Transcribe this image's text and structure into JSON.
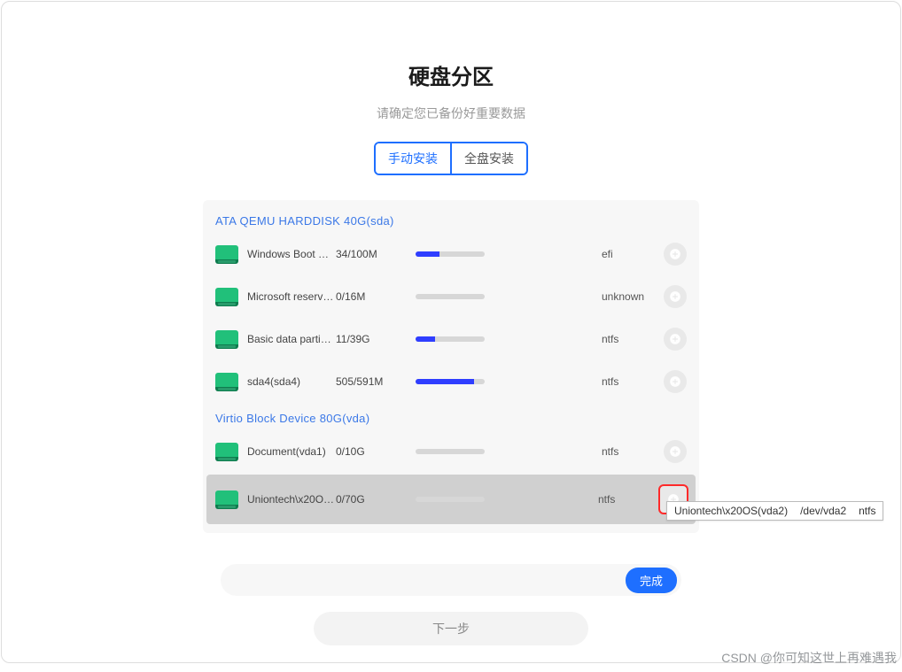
{
  "header": {
    "title": "硬盘分区",
    "subtitle": "请确定您已备份好重要数据",
    "tab_manual": "手动安装",
    "tab_full": "全盘安装"
  },
  "disks": [
    {
      "header": "ATA  QEMU  HARDDISK  40G(sda)",
      "parts": [
        {
          "name": "Windows Boot …",
          "size": "34/100M",
          "fill_pct": 34,
          "fs": "efi",
          "selected": false
        },
        {
          "name": "Microsoft reserv…",
          "size": "0/16M",
          "fill_pct": 0,
          "fs": "unknown",
          "selected": false
        },
        {
          "name": "Basic data parti…",
          "size": "11/39G",
          "fill_pct": 28,
          "fs": "ntfs",
          "selected": false
        },
        {
          "name": "sda4(sda4)",
          "size": "505/591M",
          "fill_pct": 85,
          "fs": "ntfs",
          "selected": false
        }
      ]
    },
    {
      "header": "Virtio  Block  Device  80G(vda)",
      "parts": [
        {
          "name": "Document(vda1)",
          "size": "0/10G",
          "fill_pct": 0,
          "fs": "ntfs",
          "selected": false
        },
        {
          "name": "Uniontech\\x20O…",
          "size": "0/70G",
          "fill_pct": 0,
          "fs": "ntfs",
          "selected": true
        }
      ]
    }
  ],
  "tooltip": {
    "name": "Uniontech\\x20OS(vda2)",
    "dev": "/dev/vda2",
    "fs": "ntfs"
  },
  "footer": {
    "done": "完成",
    "next": "下一步"
  },
  "watermark": "CSDN @你可知这世上再难遇我"
}
